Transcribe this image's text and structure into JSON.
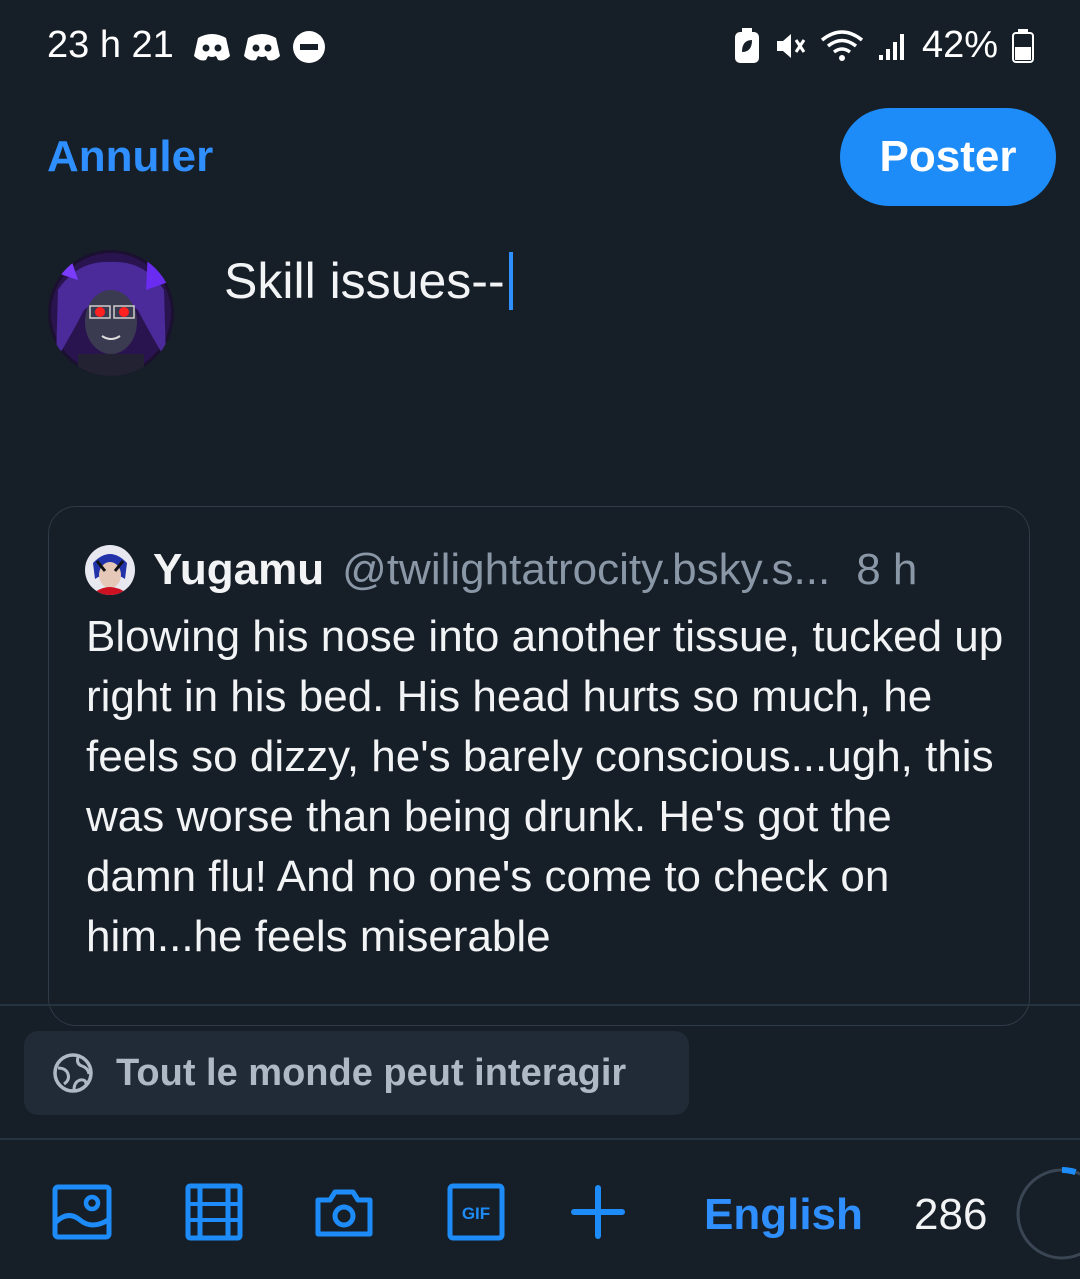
{
  "status_bar": {
    "time": "23 h 21",
    "battery_text": "42%",
    "icons": [
      "discord-icon",
      "discord-icon",
      "do-not-disturb-icon",
      "battery-saver-icon",
      "mute-vibrate-icon",
      "wifi-icon",
      "signal-icon",
      "battery-icon"
    ]
  },
  "header": {
    "cancel_label": "Annuler",
    "post_label": "Poster"
  },
  "composer": {
    "text": "Skill issues--"
  },
  "quote": {
    "author_name": "Yugamu",
    "author_handle": "@twilightatrocity.bsky.s...",
    "time": "8 h",
    "body": "Blowing his nose into another tissue, tucked up right in his bed. His head hurts so much, he feels so dizzy, he's barely conscious...ugh, this was worse than being drunk. He's got the damn flu! And no one's come to check on him...he feels miserable"
  },
  "interaction": {
    "label": "Tout le monde peut interagir"
  },
  "toolbar": {
    "language": "English",
    "char_count": "286",
    "char_used_fraction": 0.05,
    "accent_color": "#1d8cf8"
  }
}
